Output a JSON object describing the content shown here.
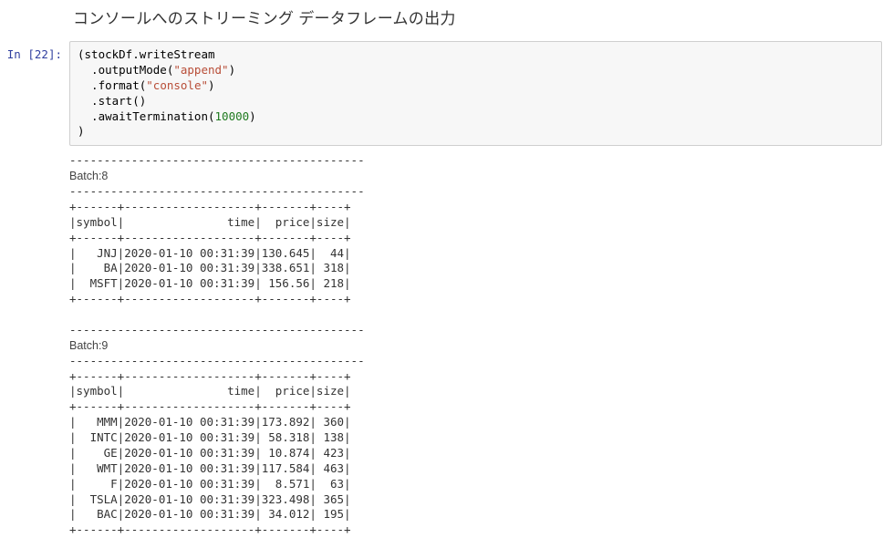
{
  "heading": "コンソールへのストリーミング データフレームの出力",
  "prompt": {
    "label": "In [",
    "count": "22",
    "suffix": "]:"
  },
  "code": {
    "l1": "(stockDf.writeStream",
    "l2_a": "  .outputMode(",
    "l2_s": "\"append\"",
    "l2_b": ")",
    "l3_a": "  .format(",
    "l3_s": "\"console\"",
    "l3_b": ")",
    "l4": "  .start()",
    "l5_a": "  .awaitTermination(",
    "l5_n": "10000",
    "l5_b": ")",
    "l6": ")"
  },
  "output": {
    "dash": "-------------------------------------------",
    "batch8_label": "Batch:8",
    "batch9_label": "Batch:9",
    "tblborder": "+------+-------------------+-------+----+",
    "header": "|symbol|               time|  price|size|",
    "b8": [
      "|   JNJ|2020-01-10 00:31:39|130.645|  44|",
      "|    BA|2020-01-10 00:31:39|338.651| 318|",
      "|  MSFT|2020-01-10 00:31:39| 156.56| 218|"
    ],
    "b9": [
      "|   MMM|2020-01-10 00:31:39|173.892| 360|",
      "|  INTC|2020-01-10 00:31:39| 58.318| 138|",
      "|    GE|2020-01-10 00:31:39| 10.874| 423|",
      "|   WMT|2020-01-10 00:31:39|117.584| 463|",
      "|     F|2020-01-10 00:31:39|  8.571|  63|",
      "|  TSLA|2020-01-10 00:31:39|323.498| 365|",
      "|   BAC|2020-01-10 00:31:39| 34.012| 195|"
    ]
  },
  "chart_data": {
    "type": "table",
    "title": "Streaming DataFrame console output",
    "columns": [
      "symbol",
      "time",
      "price",
      "size"
    ],
    "batches": [
      {
        "id": 8,
        "rows": [
          {
            "symbol": "JNJ",
            "time": "2020-01-10 00:31:39",
            "price": 130.645,
            "size": 44
          },
          {
            "symbol": "BA",
            "time": "2020-01-10 00:31:39",
            "price": 338.651,
            "size": 318
          },
          {
            "symbol": "MSFT",
            "time": "2020-01-10 00:31:39",
            "price": 156.56,
            "size": 218
          }
        ]
      },
      {
        "id": 9,
        "rows": [
          {
            "symbol": "MMM",
            "time": "2020-01-10 00:31:39",
            "price": 173.892,
            "size": 360
          },
          {
            "symbol": "INTC",
            "time": "2020-01-10 00:31:39",
            "price": 58.318,
            "size": 138
          },
          {
            "symbol": "GE",
            "time": "2020-01-10 00:31:39",
            "price": 10.874,
            "size": 423
          },
          {
            "symbol": "WMT",
            "time": "2020-01-10 00:31:39",
            "price": 117.584,
            "size": 463
          },
          {
            "symbol": "F",
            "time": "2020-01-10 00:31:39",
            "price": 8.571,
            "size": 63
          },
          {
            "symbol": "TSLA",
            "time": "2020-01-10 00:31:39",
            "price": 323.498,
            "size": 365
          },
          {
            "symbol": "BAC",
            "time": "2020-01-10 00:31:39",
            "price": 34.012,
            "size": 195
          }
        ]
      }
    ]
  }
}
